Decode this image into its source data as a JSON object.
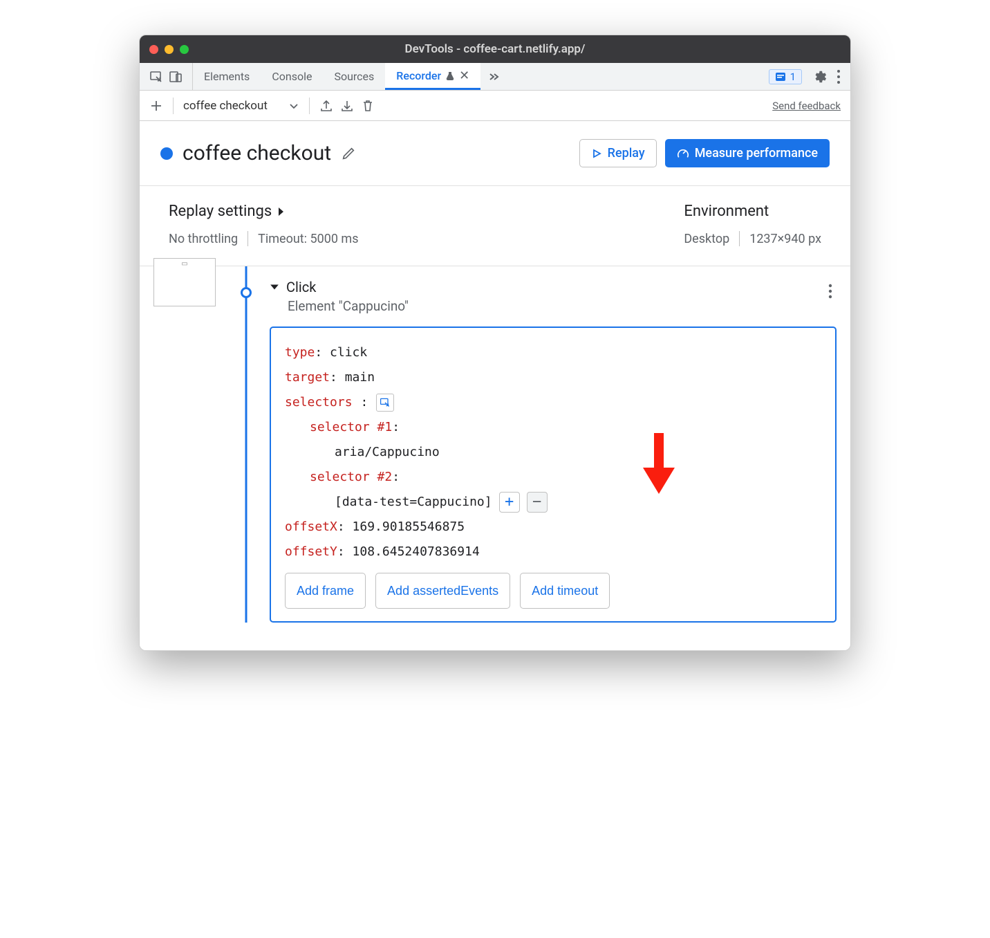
{
  "title": "DevTools - coffee-cart.netlify.app/",
  "tabs": {
    "elements": "Elements",
    "console": "Console",
    "sources": "Sources",
    "recorder": "Recorder"
  },
  "issues_count": "1",
  "toolbar": {
    "recording_name": "coffee checkout",
    "feedback": "Send feedback"
  },
  "header": {
    "recording_title": "coffee checkout",
    "replay_label": "Replay",
    "measure_label": "Measure performance"
  },
  "settings": {
    "replay_title": "Replay settings",
    "throttle": "No throttling",
    "timeout": "Timeout: 5000 ms",
    "env_title": "Environment",
    "device": "Desktop",
    "viewport": "1237×940 px"
  },
  "step": {
    "name": "Click",
    "subtitle": "Element \"Cappucino\"",
    "fields": {
      "type_key": "type",
      "type_val": "click",
      "target_key": "target",
      "target_val": "main",
      "selectors_key": "selectors",
      "sel1_key": "selector #1",
      "sel1_val": "aria/Cappucino",
      "sel2_key": "selector #2",
      "sel2_val": "[data-test=Cappucino]",
      "offsetx_key": "offsetX",
      "offsetx_val": "169.90185546875",
      "offsety_key": "offsetY",
      "offsety_val": "108.6452407836914"
    },
    "chips": {
      "frame": "Add frame",
      "asserted": "Add assertedEvents",
      "timeout": "Add timeout"
    }
  }
}
